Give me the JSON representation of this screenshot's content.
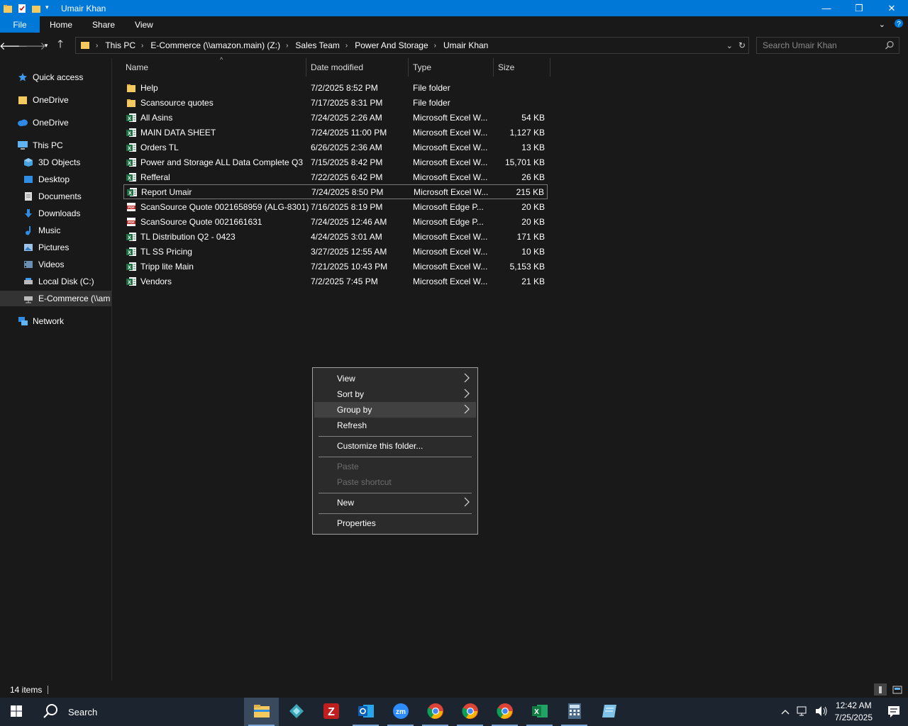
{
  "window": {
    "title": "Umair Khan",
    "controls": {
      "minimize": "—",
      "maximize": "❐",
      "close": "✕"
    }
  },
  "ribbon": {
    "tabs": [
      "File",
      "Home",
      "Share",
      "View"
    ]
  },
  "address": {
    "crumbs": [
      "This PC",
      "E-Commerce (\\\\amazon.main) (Z:)",
      "Sales Team",
      "Power And Storage",
      "Umair Khan"
    ],
    "search_placeholder": "Search Umair Khan"
  },
  "nav_pane": {
    "items": [
      {
        "label": "Quick access",
        "icon": "star-icon"
      },
      {
        "label": "OneDrive",
        "icon": "folder-icon"
      },
      {
        "label": "OneDrive",
        "icon": "cloud-icon"
      },
      {
        "label": "This PC",
        "icon": "computer-icon"
      },
      {
        "label": "3D Objects",
        "icon": "cube-icon"
      },
      {
        "label": "Desktop",
        "icon": "desktop-icon"
      },
      {
        "label": "Documents",
        "icon": "document-icon"
      },
      {
        "label": "Downloads",
        "icon": "download-icon"
      },
      {
        "label": "Music",
        "icon": "music-icon"
      },
      {
        "label": "Pictures",
        "icon": "pictures-icon"
      },
      {
        "label": "Videos",
        "icon": "videos-icon"
      },
      {
        "label": "Local Disk (C:)",
        "icon": "disk-icon"
      },
      {
        "label": "E-Commerce (\\\\am",
        "icon": "network-drive-icon"
      },
      {
        "label": "Network",
        "icon": "network-icon"
      }
    ]
  },
  "columns": {
    "name": "Name",
    "date": "Date modified",
    "type": "Type",
    "size": "Size"
  },
  "files": [
    {
      "name": "Help",
      "date": "7/2/2025 8:52 PM",
      "type": "File folder",
      "size": "",
      "kind": "folder"
    },
    {
      "name": "Scansource quotes",
      "date": "7/17/2025 8:31 PM",
      "type": "File folder",
      "size": "",
      "kind": "folder"
    },
    {
      "name": "All Asins",
      "date": "7/24/2025 2:26 AM",
      "type": "Microsoft Excel W...",
      "size": "54 KB",
      "kind": "excel"
    },
    {
      "name": "MAIN DATA SHEET",
      "date": "7/24/2025 11:00 PM",
      "type": "Microsoft Excel W...",
      "size": "1,127 KB",
      "kind": "excel"
    },
    {
      "name": "Orders TL",
      "date": "6/26/2025 2:36 AM",
      "type": "Microsoft Excel W...",
      "size": "13 KB",
      "kind": "excel"
    },
    {
      "name": "Power and Storage ALL Data Complete Q3",
      "date": "7/15/2025 8:42 PM",
      "type": "Microsoft Excel W...",
      "size": "15,701 KB",
      "kind": "excel"
    },
    {
      "name": "Refferal",
      "date": "7/22/2025 6:42 PM",
      "type": "Microsoft Excel W...",
      "size": "26 KB",
      "kind": "excel"
    },
    {
      "name": "Report Umair",
      "date": "7/24/2025 8:50 PM",
      "type": "Microsoft Excel W...",
      "size": "215 KB",
      "kind": "excel"
    },
    {
      "name": "ScanSource Quote 0021658959 (ALG-8301)",
      "date": "7/16/2025 8:19 PM",
      "type": "Microsoft Edge P...",
      "size": "20 KB",
      "kind": "pdf"
    },
    {
      "name": "ScanSource Quote 0021661631",
      "date": "7/24/2025 12:46 AM",
      "type": "Microsoft Edge P...",
      "size": "20 KB",
      "kind": "pdf"
    },
    {
      "name": "TL Distribution Q2 - 0423",
      "date": "4/24/2025 3:01 AM",
      "type": "Microsoft Excel W...",
      "size": "171 KB",
      "kind": "excel"
    },
    {
      "name": "TL SS Pricing",
      "date": "3/27/2025 12:55 AM",
      "type": "Microsoft Excel W...",
      "size": "10 KB",
      "kind": "excel"
    },
    {
      "name": "Tripp lite Main",
      "date": "7/21/2025 10:43 PM",
      "type": "Microsoft Excel W...",
      "size": "5,153 KB",
      "kind": "excel"
    },
    {
      "name": "Vendors",
      "date": "7/2/2025 7:45 PM",
      "type": "Microsoft Excel W...",
      "size": "21 KB",
      "kind": "excel"
    }
  ],
  "context_menu": {
    "items": [
      {
        "label": "View",
        "submenu": true,
        "enabled": true
      },
      {
        "label": "Sort by",
        "submenu": true,
        "enabled": true
      },
      {
        "label": "Group by",
        "submenu": true,
        "enabled": true,
        "hovered": true
      },
      {
        "label": "Refresh",
        "submenu": false,
        "enabled": true
      },
      {
        "label": "Customize this folder...",
        "submenu": false,
        "enabled": true
      },
      {
        "label": "Paste",
        "submenu": false,
        "enabled": false
      },
      {
        "label": "Paste shortcut",
        "submenu": false,
        "enabled": false
      },
      {
        "label": "New",
        "submenu": true,
        "enabled": true
      },
      {
        "label": "Properties",
        "submenu": false,
        "enabled": true
      }
    ]
  },
  "status": {
    "count": "14 items"
  },
  "taskbar": {
    "search_label": "Search",
    "apps": [
      "file-explorer",
      "app-diamond",
      "filezilla",
      "outlook",
      "zoom",
      "chrome",
      "chrome-2",
      "chrome-3",
      "excel",
      "calculator",
      "notepad-app"
    ],
    "time": "12:42 AM",
    "date": "7/25/2025"
  },
  "colors": {
    "accent": "#0078d7",
    "background": "#191919",
    "excel": "#1d6f42",
    "pdf": "#c4302b",
    "folder": "#f4c95d"
  }
}
